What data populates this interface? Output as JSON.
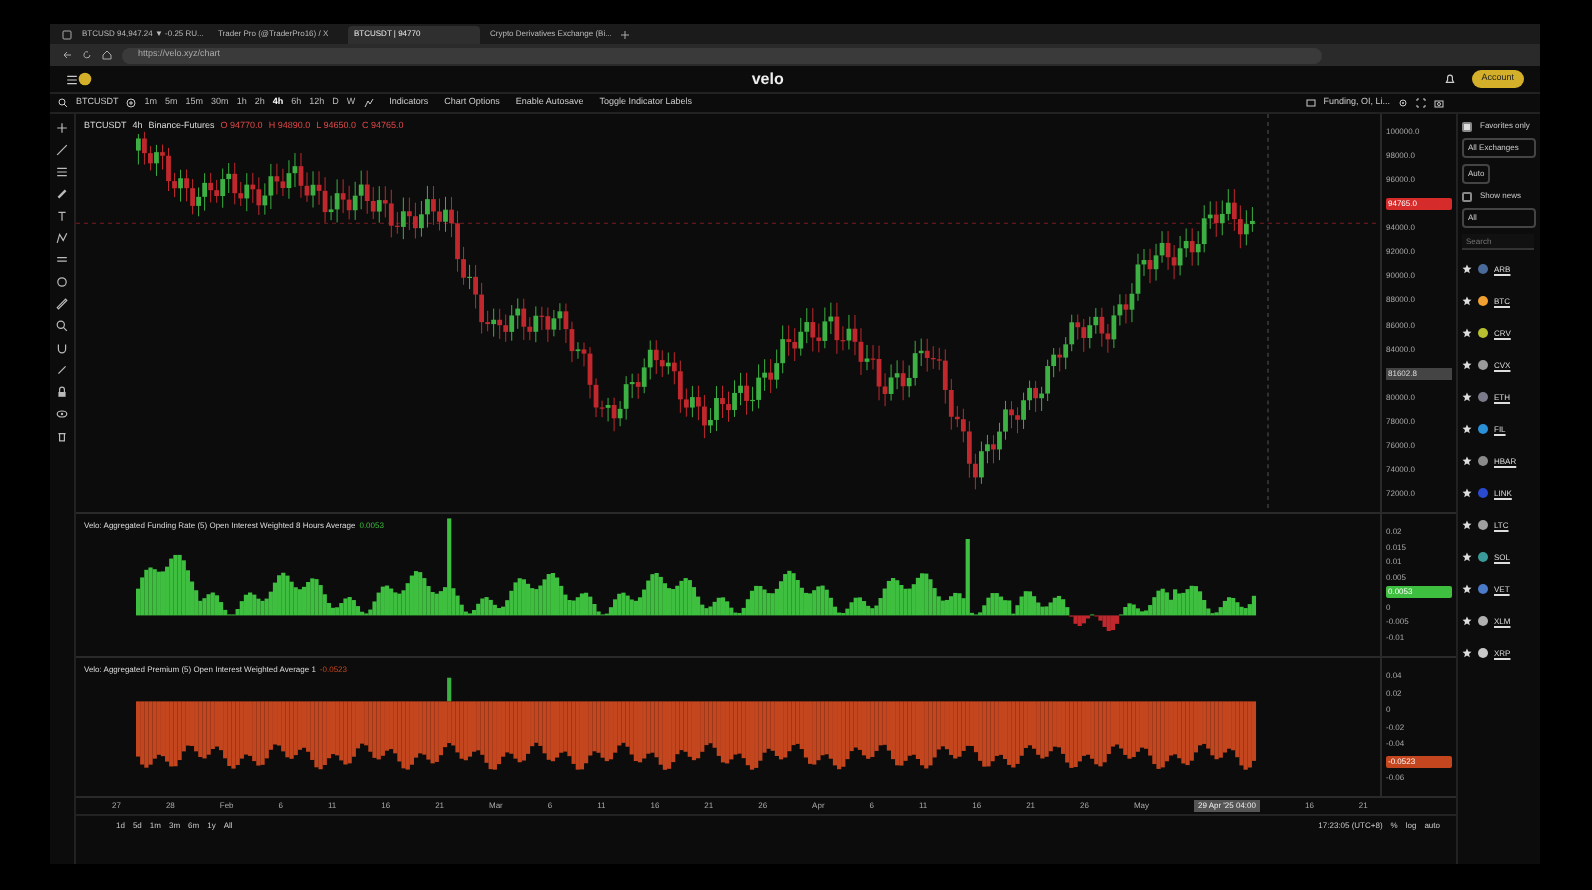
{
  "browser": {
    "tabs": [
      {
        "label": "BTCUSD 94,947.24 ▼ -0.25 RU...",
        "selected": false
      },
      {
        "label": "Trader Pro (@TraderPro16) / X",
        "selected": false
      },
      {
        "label": "BTCUSDT | 94770",
        "selected": true
      },
      {
        "label": "Crypto Derivatives Exchange (Bi...",
        "selected": false
      }
    ],
    "address": "https://velo.xyz/chart"
  },
  "app": {
    "logo": "velo",
    "account_button": "Account"
  },
  "toolbar": {
    "symbol": "BTCUSDT",
    "timeframes": [
      {
        "label": "1m",
        "selected": false
      },
      {
        "label": "5m",
        "selected": false
      },
      {
        "label": "15m",
        "selected": false
      },
      {
        "label": "30m",
        "selected": false
      },
      {
        "label": "1h",
        "selected": false
      },
      {
        "label": "2h",
        "selected": false
      },
      {
        "label": "4h",
        "selected": true
      },
      {
        "label": "6h",
        "selected": false
      },
      {
        "label": "12h",
        "selected": false
      },
      {
        "label": "D",
        "selected": false
      },
      {
        "label": "W",
        "selected": false
      }
    ],
    "buttons": [
      "Indicators",
      "Chart Options",
      "Enable Autosave",
      "Toggle Indicator Labels"
    ],
    "layout_label": "Funding, OI, Li..."
  },
  "legend": {
    "symbol": "BTCUSDT",
    "interval": "4h",
    "exchange": "Binance-Futures",
    "ohlc": [
      {
        "key": "O",
        "value": "94770.0"
      },
      {
        "key": "H",
        "value": "94890.0"
      },
      {
        "key": "L",
        "value": "94650.0"
      },
      {
        "key": "C",
        "value": "94765.0"
      }
    ]
  },
  "price_axis": {
    "labels": [
      {
        "text": "100000.0",
        "kind": "tick"
      },
      {
        "text": "98000.0",
        "kind": "tick"
      },
      {
        "text": "96000.0",
        "kind": "tick"
      },
      {
        "text": "94765.0",
        "kind": "last"
      },
      {
        "text": "94000.0",
        "kind": "tick"
      },
      {
        "text": "92000.0",
        "kind": "tick"
      },
      {
        "text": "90000.0",
        "kind": "tick"
      },
      {
        "text": "88000.0",
        "kind": "tick"
      },
      {
        "text": "86000.0",
        "kind": "tick"
      },
      {
        "text": "84000.0",
        "kind": "tick"
      },
      {
        "text": "81602.8",
        "kind": "cursor"
      },
      {
        "text": "80000.0",
        "kind": "tick"
      },
      {
        "text": "78000.0",
        "kind": "tick"
      },
      {
        "text": "76000.0",
        "kind": "tick"
      },
      {
        "text": "74000.0",
        "kind": "tick"
      },
      {
        "text": "72000.0",
        "kind": "tick"
      }
    ]
  },
  "indicators": [
    {
      "title": "Velo: Aggregated Funding Rate (5) Open Interest Weighted 8 Hours Average",
      "value": "0.0053",
      "kind": "funding",
      "color": "#3fbf3f",
      "axis_labels": [
        {
          "text": "0.02",
          "kind": "tick"
        },
        {
          "text": "0.015",
          "kind": "tick"
        },
        {
          "text": "0.01",
          "kind": "tick"
        },
        {
          "text": "0.005",
          "kind": "tick"
        },
        {
          "text": "0.0053",
          "kind": "last"
        },
        {
          "text": "0",
          "kind": "tick"
        },
        {
          "text": "-0.005",
          "kind": "tick"
        },
        {
          "text": "-0.01",
          "kind": "tick"
        }
      ]
    },
    {
      "title": "Velo: Aggregated Premium (5) Open Interest Weighted Average 1",
      "value": "-0.0523",
      "kind": "premium",
      "color": "#c4461f",
      "axis_labels": [
        {
          "text": "0.04",
          "kind": "tick"
        },
        {
          "text": "0.02",
          "kind": "tick"
        },
        {
          "text": "0",
          "kind": "tick"
        },
        {
          "text": "-0.02",
          "kind": "tick"
        },
        {
          "text": "-0.04",
          "kind": "tick"
        },
        {
          "text": "-0.0523",
          "kind": "last"
        },
        {
          "text": "-0.06",
          "kind": "tick"
        }
      ]
    }
  ],
  "time_axis": {
    "labels": [
      "27",
      "28",
      "Feb",
      "6",
      "11",
      "16",
      "21",
      "Mar",
      "6",
      "11",
      "16",
      "21",
      "26",
      "Apr",
      "6",
      "11",
      "16",
      "21",
      "26",
      "May"
    ],
    "cursor_label": "29 Apr '25 04:00",
    "labels_after": [
      "16",
      "21"
    ]
  },
  "bottom_bar": {
    "ranges": [
      "1d",
      "5d",
      "1m",
      "3m",
      "6m",
      "1y",
      "All"
    ],
    "clock": "17:23:05 (UTC+8)",
    "options": [
      "%",
      "log",
      "auto"
    ]
  },
  "sidebar": {
    "favorites_only": {
      "label": "Favorites only",
      "checked": true
    },
    "exchange_select": "All Exchanges",
    "auto_button": "Auto",
    "show_news": {
      "label": "Show news",
      "checked": false
    },
    "filter_select": "All",
    "search_placeholder": "Search",
    "coins": [
      {
        "symbol": "ARB",
        "color": "#4a6a9a"
      },
      {
        "symbol": "BTC",
        "color": "#f0a030"
      },
      {
        "symbol": "CRV",
        "color": "#b8c030"
      },
      {
        "symbol": "CVX",
        "color": "#9a9a9a"
      },
      {
        "symbol": "ETH",
        "color": "#7a7a8a"
      },
      {
        "symbol": "FIL",
        "color": "#2a90d8"
      },
      {
        "symbol": "HBAR",
        "color": "#8a8a8a"
      },
      {
        "symbol": "LINK",
        "color": "#2a4ad0"
      },
      {
        "symbol": "LTC",
        "color": "#a0a0a0"
      },
      {
        "symbol": "SOL",
        "color": "#3a9a9a"
      },
      {
        "symbol": "VET",
        "color": "#4a7ac8"
      },
      {
        "symbol": "XLM",
        "color": "#b0b0b0"
      },
      {
        "symbol": "XRP",
        "color": "#c8c8c8"
      }
    ]
  }
}
